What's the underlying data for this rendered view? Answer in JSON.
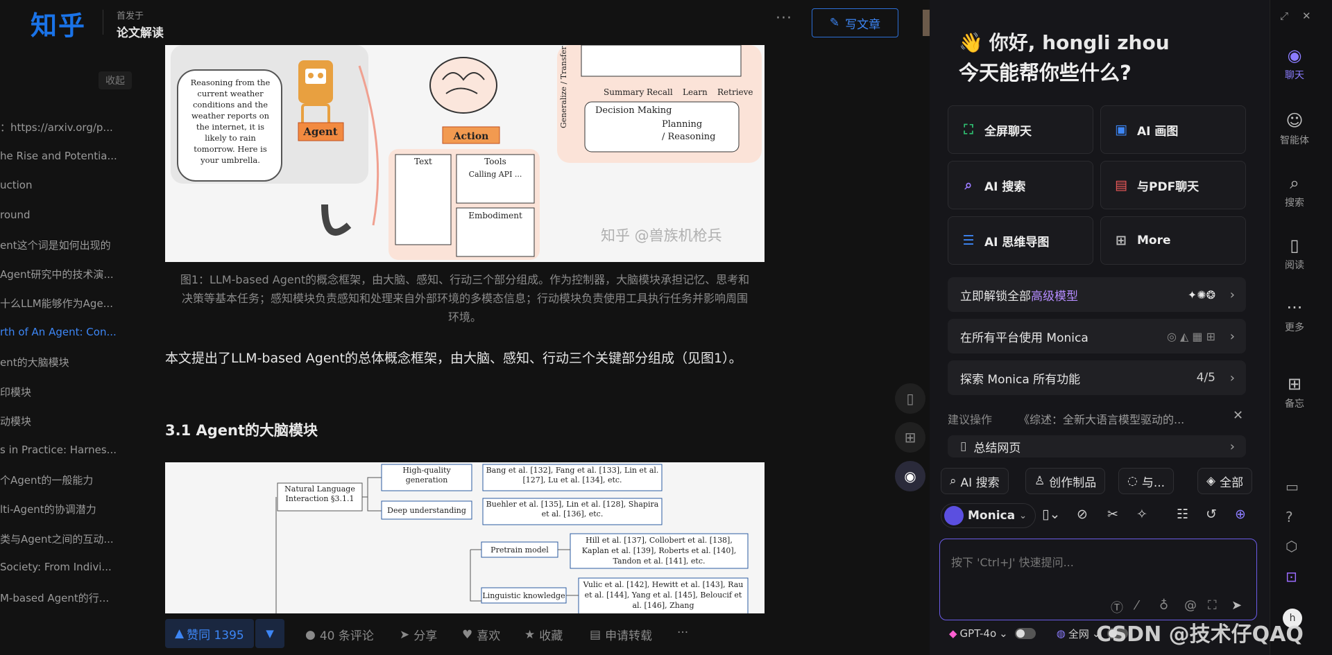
{
  "header": {
    "logo": "知乎",
    "published_in_label": "首发于",
    "column_name": "论文解读",
    "more": "···",
    "write_button": "写文章"
  },
  "outline": {
    "collapse_label": "收起",
    "items": [
      "：https://arxiv.org/p...",
      "he Rise and Potentia...",
      "uction",
      "round",
      "ent这个词是如何出现的",
      "Agent研究中的技术演...",
      "十么LLM能够作为Age...",
      "rth of An Agent: Con...",
      "ent的大脑模块",
      "印模块",
      "动模块",
      "s in Practice: Harnes...",
      "个Agent的一般能力",
      "lti-Agent的协调潜力",
      "类与Agent之间的互动...",
      " Society: From Indivi...",
      "M-based Agent的行..."
    ],
    "active_index": 7
  },
  "article": {
    "figure1": {
      "bubble_text": "Reasoning from the current weather conditions and the weather reports on the internet, it is likely to rain tomorrow. Here is your umbrella.",
      "agent_label": "Agent",
      "action_label": "Action",
      "text_label": "Text",
      "tools_label": "Tools",
      "calling_api": "Calling API ...",
      "embodiment_label": "Embodiment",
      "generalize_label": "Generalize / Transfer",
      "summary": "Summary",
      "recall": "Recall",
      "learn": "Learn",
      "retrieve": "Retrieve",
      "decision_making": "Decision Making",
      "planning": "Planning",
      "reasoning": "/ Reasoning",
      "watermark": "知乎 @兽族机枪兵"
    },
    "caption": "图1：LLM-based Agent的概念框架，由大脑、感知、行动三个部分组成。作为控制器，大脑模块承担记忆、思考和决策等基本任务；感知模块负责感知和处理来自外部环境的多模态信息；行动模块负责使用工具执行任务并影响周围环境。",
    "paragraph": "本文提出了LLM-based Agent的总体概念框架，由大脑、感知、行动三个关键部分组成（见图1）。",
    "heading": "3.1 Agent的大脑模块",
    "figure2": {
      "root": "Natural Language Interaction §3.1.1",
      "n1": "High-quality generation",
      "n1_refs": "Bang et al. [132], Fang et al. [133], Lin et al. [127], Lu et al. [134], etc.",
      "n2": "Deep understanding",
      "n2_refs": "Buehler et al. [135], Lin et al. [128], Shapira et al. [136], etc.",
      "n3": "Pretrain model",
      "n3_refs": "Hill et al. [137], Collobert et al. [138], Kaplan et al. [139], Roberts et al. [140], Tandon et al. [141], etc.",
      "n4": "Linguistic knowledge",
      "n4_refs": "Vulic et al. [142], Hewitt et al. [143], Rau et al. [144], Yang et al. [145], Beloucif et al. [146], Zhang"
    }
  },
  "actions": {
    "upvote": "赞同 1395",
    "comments": "40 条评论",
    "share": "分享",
    "like": "喜欢",
    "collect": "收藏",
    "reprint": "申请转载",
    "more": "···"
  },
  "monica": {
    "greeting_name": "你好, hongli zhou",
    "greeting_question": "今天能帮你些什么?",
    "tiles": [
      "全屏聊天",
      "AI 画图",
      "AI 搜索",
      "与PDF聊天",
      "AI 思维导图",
      "More"
    ],
    "unlock_prefix": "立即解锁全部",
    "unlock_highlight": "高级模型",
    "all_platforms": "在所有平台使用 Monica",
    "explore": "探索 Monica 所有功能",
    "explore_progress": "4/5",
    "suggest_label": "建议操作",
    "suggest_title": "《综述：全新大语言模型驱动的...",
    "summarize": "总结网页",
    "chips": [
      "AI 搜索",
      "创作制品",
      "与...",
      "全部"
    ],
    "bot_name": "Monica",
    "input_placeholder": "按下 'Ctrl+J' 快速提问...",
    "model": "GPT-4o",
    "web": "全网"
  },
  "rail": {
    "chat": "聊天",
    "agent": "智能体",
    "search": "搜索",
    "read": "阅读",
    "more": "更多",
    "memo": "备忘"
  },
  "watermark": "CSDN @技术仔QAQ",
  "colors": {
    "zhihu_blue": "#1a73e8",
    "monica_purple": "#8b7cff",
    "link_blue": "#3d86f5"
  }
}
